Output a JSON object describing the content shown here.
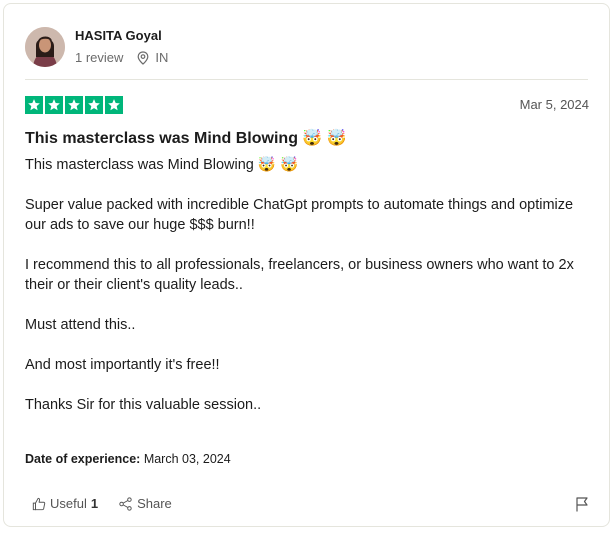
{
  "reviewer": {
    "name": "HASITA Goyal",
    "reviews": "1 review",
    "country": "IN"
  },
  "rating": {
    "stars": 5,
    "max": 5,
    "color": "#00b67a"
  },
  "review": {
    "date": "Mar 5, 2024",
    "title": "This masterclass was Mind Blowing 🤯 🤯",
    "paragraphs": [
      "This masterclass was Mind Blowing 🤯 🤯",
      "Super value packed with incredible ChatGpt prompts to automate things and optimize our ads to save our huge $$$ burn!!",
      "I recommend this to all professionals, freelancers, or business owners who want to 2x their or their client's quality leads..",
      "Must attend this..",
      "And most importantly it's free!!",
      "Thanks Sir for this valuable session.."
    ],
    "experience_label": "Date of experience:",
    "experience_date": "March 03, 2024"
  },
  "actions": {
    "useful_label": "Useful",
    "useful_count": "1",
    "share_label": "Share"
  },
  "icons": {
    "location": "location-pin-icon",
    "useful": "thumbs-up-icon",
    "share": "share-icon",
    "flag": "flag-icon",
    "star": "star-icon"
  }
}
